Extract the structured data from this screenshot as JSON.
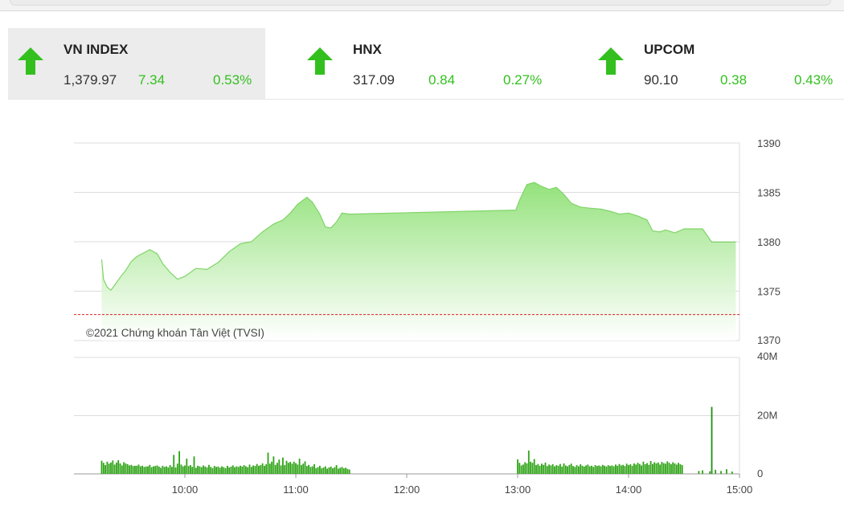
{
  "indices": [
    {
      "name": "VN INDEX",
      "value": "1,379.97",
      "change": "7.34",
      "percent": "0.53%",
      "direction": "up",
      "active": true
    },
    {
      "name": "HNX",
      "value": "317.09",
      "change": "0.84",
      "percent": "0.27%",
      "direction": "up",
      "active": false
    },
    {
      "name": "UPCOM",
      "value": "90.10",
      "change": "0.38",
      "percent": "0.43%",
      "direction": "up",
      "active": false
    }
  ],
  "colors": {
    "up": "#33c01f",
    "area_top": "#93e27b",
    "area_bottom": "#ffffff",
    "reference": "#e02020",
    "volume": "#2ea316",
    "spike": "#1f8f12"
  },
  "chart_data": {
    "type": "area",
    "watermark": "©2021 Chứng khoán Tân Việt (TVSI)",
    "price": {
      "ylim": [
        1370,
        1390
      ],
      "yticks": [
        "1390",
        "1385",
        "1380",
        "1375",
        "1370"
      ],
      "reference": 1372.63,
      "points": [
        [
          "09:15",
          1378.2
        ],
        [
          "09:16",
          1376.2
        ],
        [
          "09:18",
          1375.4
        ],
        [
          "09:20",
          1375.1
        ],
        [
          "09:22",
          1375.6
        ],
        [
          "09:25",
          1376.4
        ],
        [
          "09:28",
          1377.1
        ],
        [
          "09:31",
          1378.0
        ],
        [
          "09:34",
          1378.5
        ],
        [
          "09:38",
          1378.9
        ],
        [
          "09:41",
          1379.2
        ],
        [
          "09:45",
          1378.8
        ],
        [
          "09:48",
          1377.8
        ],
        [
          "09:52",
          1376.9
        ],
        [
          "09:56",
          1376.2
        ],
        [
          "10:00",
          1376.5
        ],
        [
          "10:06",
          1377.3
        ],
        [
          "10:12",
          1377.2
        ],
        [
          "10:18",
          1377.9
        ],
        [
          "10:24",
          1379.0
        ],
        [
          "10:30",
          1379.8
        ],
        [
          "10:36",
          1380.0
        ],
        [
          "10:42",
          1381.0
        ],
        [
          "10:48",
          1381.8
        ],
        [
          "10:53",
          1382.2
        ],
        [
          "10:57",
          1382.9
        ],
        [
          "11:01",
          1383.8
        ],
        [
          "11:06",
          1384.5
        ],
        [
          "11:09",
          1384.0
        ],
        [
          "11:13",
          1382.8
        ],
        [
          "11:16",
          1381.5
        ],
        [
          "11:19",
          1381.4
        ],
        [
          "11:22",
          1382.0
        ],
        [
          "11:25",
          1382.9
        ],
        [
          "11:29",
          1382.8
        ],
        [
          "12:59",
          1383.2
        ],
        [
          "13:01",
          1384.2
        ],
        [
          "13:05",
          1385.8
        ],
        [
          "13:09",
          1386.0
        ],
        [
          "13:13",
          1385.6
        ],
        [
          "13:17",
          1385.3
        ],
        [
          "13:21",
          1385.5
        ],
        [
          "13:25",
          1384.8
        ],
        [
          "13:29",
          1383.9
        ],
        [
          "13:34",
          1383.5
        ],
        [
          "13:39",
          1383.4
        ],
        [
          "13:45",
          1383.3
        ],
        [
          "13:50",
          1383.1
        ],
        [
          "13:55",
          1382.8
        ],
        [
          "14:00",
          1382.9
        ],
        [
          "14:05",
          1382.6
        ],
        [
          "14:10",
          1382.2
        ],
        [
          "14:13",
          1381.1
        ],
        [
          "14:17",
          1381.0
        ],
        [
          "14:20",
          1381.2
        ],
        [
          "14:25",
          1380.9
        ],
        [
          "14:30",
          1381.3
        ],
        [
          "14:40",
          1381.3
        ],
        [
          "14:45",
          1379.97
        ],
        [
          "14:58",
          1379.97
        ]
      ]
    },
    "volume": {
      "ylim": [
        0,
        40
      ],
      "unit": "M",
      "yticks": [
        "40M",
        "20M",
        "0"
      ],
      "bars": [
        [
          "09:15",
          4.5
        ],
        [
          "09:16",
          3.8
        ],
        [
          "09:17",
          3.0
        ],
        [
          "09:18",
          4.2
        ],
        [
          "09:19",
          3.5
        ],
        [
          "09:20",
          3.9
        ],
        [
          "09:21",
          4.6
        ],
        [
          "09:22",
          3.2
        ],
        [
          "09:23",
          3.9
        ],
        [
          "09:24",
          4.7
        ],
        [
          "09:25",
          3.6
        ],
        [
          "09:26",
          2.9
        ],
        [
          "09:27",
          4.0
        ],
        [
          "09:28",
          3.6
        ],
        [
          "09:29",
          3.3
        ],
        [
          "09:30",
          2.9
        ],
        [
          "09:31",
          3.1
        ],
        [
          "09:32",
          2.7
        ],
        [
          "09:33",
          2.8
        ],
        [
          "09:34",
          2.8
        ],
        [
          "09:35",
          3.2
        ],
        [
          "09:36",
          2.6
        ],
        [
          "09:37",
          2.8
        ],
        [
          "09:38",
          2.4
        ],
        [
          "09:39",
          2.5
        ],
        [
          "09:40",
          2.6
        ],
        [
          "09:41",
          3.1
        ],
        [
          "09:42",
          2.3
        ],
        [
          "09:43",
          2.6
        ],
        [
          "09:44",
          2.7
        ],
        [
          "09:45",
          2.9
        ],
        [
          "09:46",
          2.5
        ],
        [
          "09:47",
          2.1
        ],
        [
          "09:48",
          2.8
        ],
        [
          "09:49",
          2.4
        ],
        [
          "09:50",
          2.6
        ],
        [
          "09:51",
          2.2
        ],
        [
          "09:52",
          3.0
        ],
        [
          "09:53",
          2.4
        ],
        [
          "09:54",
          6.5
        ],
        [
          "09:55",
          2.2
        ],
        [
          "09:56",
          3.5
        ],
        [
          "09:57",
          7.8
        ],
        [
          "09:58",
          3.2
        ],
        [
          "09:59",
          2.6
        ],
        [
          "10:00",
          2.9
        ],
        [
          "10:01",
          5.2
        ],
        [
          "10:02",
          2.7
        ],
        [
          "10:03",
          3.0
        ],
        [
          "10:04",
          2.4
        ],
        [
          "10:05",
          6.0
        ],
        [
          "10:06",
          2.1
        ],
        [
          "10:07",
          2.8
        ],
        [
          "10:08",
          2.6
        ],
        [
          "10:09",
          2.3
        ],
        [
          "10:10",
          2.9
        ],
        [
          "10:11",
          2.5
        ],
        [
          "10:12",
          2.2
        ],
        [
          "10:13",
          3.1
        ],
        [
          "10:14",
          2.4
        ],
        [
          "10:15",
          2.0
        ],
        [
          "10:16",
          2.7
        ],
        [
          "10:17",
          2.4
        ],
        [
          "10:18",
          2.5
        ],
        [
          "10:19",
          2.1
        ],
        [
          "10:20",
          2.6
        ],
        [
          "10:21",
          2.3
        ],
        [
          "10:22",
          2.0
        ],
        [
          "10:23",
          2.8
        ],
        [
          "10:24",
          2.2
        ],
        [
          "10:25",
          2.5
        ],
        [
          "10:26",
          2.9
        ],
        [
          "10:27",
          2.3
        ],
        [
          "10:28",
          2.6
        ],
        [
          "10:29",
          2.4
        ],
        [
          "10:30",
          2.8
        ],
        [
          "10:31",
          2.5
        ],
        [
          "10:32",
          3.0
        ],
        [
          "10:33",
          2.6
        ],
        [
          "10:34",
          2.3
        ],
        [
          "10:35",
          3.2
        ],
        [
          "10:36",
          2.4
        ],
        [
          "10:37",
          2.9
        ],
        [
          "10:38",
          2.7
        ],
        [
          "10:39",
          3.4
        ],
        [
          "10:40",
          2.8
        ],
        [
          "10:41",
          3.0
        ],
        [
          "10:42",
          3.6
        ],
        [
          "10:43",
          2.8
        ],
        [
          "10:44",
          3.3
        ],
        [
          "10:45",
          7.3
        ],
        [
          "10:46",
          3.5
        ],
        [
          "10:47",
          4.2
        ],
        [
          "10:48",
          6.0
        ],
        [
          "10:49",
          3.1
        ],
        [
          "10:50",
          3.8
        ],
        [
          "10:51",
          4.9
        ],
        [
          "10:52",
          2.9
        ],
        [
          "10:53",
          5.6
        ],
        [
          "10:54",
          3.0
        ],
        [
          "10:55",
          4.5
        ],
        [
          "10:56",
          3.8
        ],
        [
          "10:57",
          4.1
        ],
        [
          "10:58",
          3.5
        ],
        [
          "10:59",
          4.2
        ],
        [
          "11:00",
          3.7
        ],
        [
          "11:01",
          3.2
        ],
        [
          "11:02",
          5.2
        ],
        [
          "11:03",
          3.0
        ],
        [
          "11:04",
          3.5
        ],
        [
          "11:05",
          4.3
        ],
        [
          "11:06",
          2.7
        ],
        [
          "11:07",
          3.1
        ],
        [
          "11:08",
          2.4
        ],
        [
          "11:09",
          2.6
        ],
        [
          "11:10",
          3.3
        ],
        [
          "11:11",
          2.0
        ],
        [
          "11:12",
          2.3
        ],
        [
          "11:13",
          2.8
        ],
        [
          "11:14",
          1.9
        ],
        [
          "11:15",
          2.2
        ],
        [
          "11:16",
          2.6
        ],
        [
          "11:17",
          1.8
        ],
        [
          "11:18",
          2.2
        ],
        [
          "11:19",
          2.5
        ],
        [
          "11:20",
          1.9
        ],
        [
          "11:21",
          2.3
        ],
        [
          "11:22",
          3.0
        ],
        [
          "11:23",
          1.8
        ],
        [
          "11:24",
          2.1
        ],
        [
          "11:25",
          2.4
        ],
        [
          "11:26",
          1.9
        ],
        [
          "11:27",
          2.1
        ],
        [
          "11:28",
          1.7
        ],
        [
          "11:29",
          1.5
        ],
        [
          "13:00",
          5.0
        ],
        [
          "13:01",
          3.8
        ],
        [
          "13:02",
          2.9
        ],
        [
          "13:03",
          3.2
        ],
        [
          "13:04",
          4.0
        ],
        [
          "13:05",
          3.6
        ],
        [
          "13:06",
          8.0
        ],
        [
          "13:07",
          4.2
        ],
        [
          "13:08",
          3.8
        ],
        [
          "13:09",
          5.1
        ],
        [
          "13:10",
          3.0
        ],
        [
          "13:11",
          3.4
        ],
        [
          "13:12",
          2.8
        ],
        [
          "13:13",
          3.5
        ],
        [
          "13:14",
          3.1
        ],
        [
          "13:15",
          3.9
        ],
        [
          "13:16",
          2.7
        ],
        [
          "13:17",
          3.2
        ],
        [
          "13:18",
          2.9
        ],
        [
          "13:19",
          3.3
        ],
        [
          "13:20",
          2.6
        ],
        [
          "13:21",
          3.0
        ],
        [
          "13:22",
          2.8
        ],
        [
          "13:23",
          3.4
        ],
        [
          "13:24",
          2.5
        ],
        [
          "13:25",
          3.6
        ],
        [
          "13:26",
          2.9
        ],
        [
          "13:27",
          2.6
        ],
        [
          "13:28",
          3.1
        ],
        [
          "13:29",
          3.5
        ],
        [
          "13:30",
          2.7
        ],
        [
          "13:31",
          2.4
        ],
        [
          "13:32",
          3.0
        ],
        [
          "13:33",
          2.6
        ],
        [
          "13:34",
          3.3
        ],
        [
          "13:35",
          2.8
        ],
        [
          "13:36",
          2.5
        ],
        [
          "13:37",
          2.9
        ],
        [
          "13:38",
          3.2
        ],
        [
          "13:39",
          2.6
        ],
        [
          "13:40",
          2.8
        ],
        [
          "13:41",
          2.4
        ],
        [
          "13:42",
          3.0
        ],
        [
          "13:43",
          2.7
        ],
        [
          "13:44",
          2.9
        ],
        [
          "13:45",
          2.6
        ],
        [
          "13:46",
          3.1
        ],
        [
          "13:47",
          2.8
        ],
        [
          "13:48",
          2.5
        ],
        [
          "13:49",
          3.0
        ],
        [
          "13:50",
          2.7
        ],
        [
          "13:51",
          2.9
        ],
        [
          "13:52",
          2.6
        ],
        [
          "13:53",
          3.2
        ],
        [
          "13:54",
          2.8
        ],
        [
          "13:55",
          3.4
        ],
        [
          "13:56",
          2.9
        ],
        [
          "13:57",
          3.1
        ],
        [
          "13:58",
          2.7
        ],
        [
          "13:59",
          3.5
        ],
        [
          "14:00",
          3.0
        ],
        [
          "14:01",
          3.3
        ],
        [
          "14:02",
          2.8
        ],
        [
          "14:03",
          3.6
        ],
        [
          "14:04",
          3.2
        ],
        [
          "14:05",
          3.8
        ],
        [
          "14:06",
          3.4
        ],
        [
          "14:07",
          2.9
        ],
        [
          "14:08",
          4.2
        ],
        [
          "14:09",
          3.3
        ],
        [
          "14:10",
          3.7
        ],
        [
          "14:11",
          3.1
        ],
        [
          "14:12",
          4.4
        ],
        [
          "14:13",
          3.4
        ],
        [
          "14:14",
          4.0
        ],
        [
          "14:15",
          3.6
        ],
        [
          "14:16",
          3.9
        ],
        [
          "14:17",
          3.2
        ],
        [
          "14:18",
          4.1
        ],
        [
          "14:19",
          3.7
        ],
        [
          "14:20",
          3.5
        ],
        [
          "14:21",
          4.3
        ],
        [
          "14:22",
          3.8
        ],
        [
          "14:23",
          3.3
        ],
        [
          "14:24",
          4.0
        ],
        [
          "14:25",
          3.6
        ],
        [
          "14:26",
          3.2
        ],
        [
          "14:27",
          3.8
        ],
        [
          "14:28",
          3.3
        ],
        [
          "14:29",
          3.0
        ],
        [
          "14:38",
          1.0
        ],
        [
          "14:40",
          1.2
        ],
        [
          "14:44",
          0.9
        ],
        [
          "14:45",
          23.0
        ],
        [
          "14:47",
          1.4
        ],
        [
          "14:50",
          1.0
        ],
        [
          "14:53",
          1.6
        ],
        [
          "14:56",
          0.8
        ]
      ]
    },
    "xticks": [
      "10:00",
      "11:00",
      "12:00",
      "13:00",
      "14:00",
      "15:00"
    ]
  }
}
